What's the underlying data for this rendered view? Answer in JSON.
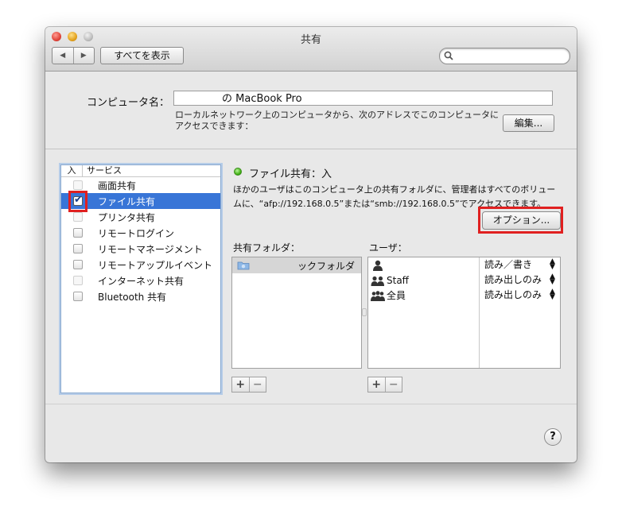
{
  "window": {
    "title": "共有"
  },
  "toolbar": {
    "back_label": "◀",
    "forward_label": "▶",
    "show_all_label": "すべてを表示",
    "search_value": ""
  },
  "computer_name": {
    "label": "コンピュータ名：",
    "value": "の MacBook Pro",
    "description": "ローカルネットワーク上のコンピュータから、次のアドレスでこのコンピュータにアクセスできます：",
    "edit_label": "編集..."
  },
  "services": {
    "header_on": "入",
    "header_service": "サービス",
    "items": [
      {
        "label": "画面共有",
        "checked": false
      },
      {
        "label": "ファイル共有",
        "checked": true,
        "selected": true
      },
      {
        "label": "プリンタ共有",
        "checked": false
      },
      {
        "label": "リモートログイン",
        "checked": false
      },
      {
        "label": "リモートマネージメント",
        "checked": false
      },
      {
        "label": "リモートアップルイベント",
        "checked": false
      },
      {
        "label": "インターネット共有",
        "checked": false
      },
      {
        "label": "Bluetooth 共有",
        "checked": false
      }
    ]
  },
  "detail": {
    "status": "ファイル共有：入",
    "status_color": "#3fae12",
    "description": "ほかのユーザはこのコンピュータ上の共有フォルダに、管理者はすべてのボリュームに、“afp://192.168.0.5”または“smb://192.168.0.5”でアクセスできます。",
    "options_label": "オプション..."
  },
  "shared_folders": {
    "label": "共有フォルダ：",
    "items": [
      {
        "name": "ックフォルダ"
      }
    ]
  },
  "users": {
    "label": "ユーザ：",
    "items": [
      {
        "name": "",
        "permission": "読み／書き",
        "icon": "person-icon"
      },
      {
        "name": "Staff",
        "permission": "読み出しのみ",
        "icon": "group-icon"
      },
      {
        "name": "全員",
        "permission": "読み出しのみ",
        "icon": "group-icon"
      }
    ]
  },
  "buttons": {
    "plus": "+",
    "minus": "−",
    "help": "?"
  },
  "highlight_color": "#e02020"
}
